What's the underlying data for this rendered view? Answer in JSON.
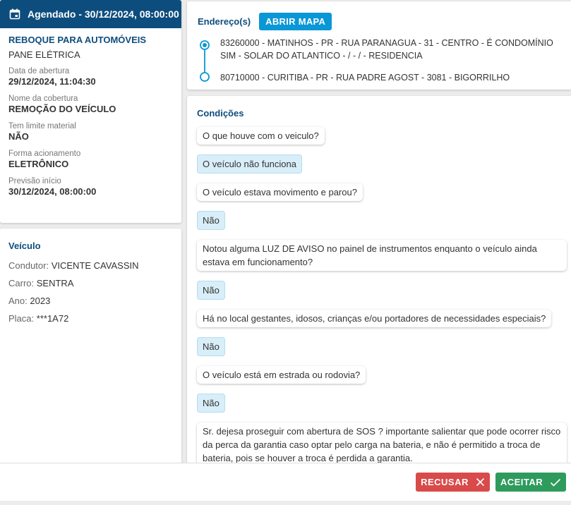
{
  "schedule": {
    "header": "Agendado - 30/12/2024, 08:00:00",
    "service_title": "REBOQUE PARA AUTOMÓVEIS",
    "service_reason": "PANE ELÉTRICA",
    "fields": [
      {
        "label": "Data de abertura",
        "value": "29/12/2024, 11:04:30"
      },
      {
        "label": "Nome da cobertura",
        "value": "REMOÇÃO DO VEÍCULO"
      },
      {
        "label": "Tem limite material",
        "value": "NÃO"
      },
      {
        "label": "Forma acionamento",
        "value": "ELETRÔNICO"
      },
      {
        "label": "Previsão início",
        "value": "30/12/2024, 08:00:00"
      }
    ]
  },
  "vehicle": {
    "title": "Veículo",
    "rows": [
      {
        "label": "Condutor:",
        "value": "VICENTE CAVASSIN"
      },
      {
        "label": "Carro:",
        "value": "SENTRA"
      },
      {
        "label": "Ano:",
        "value": "2023"
      },
      {
        "label": "Placa:",
        "value": "***1A72"
      }
    ]
  },
  "addresses": {
    "label": "Endereço(s)",
    "map_button": "ABRIR MAPA",
    "items": [
      "83260000 - MATINHOS - PR - RUA PARANAGUA - 31 - CENTRO - É CONDOMÍNIO SIM - SOLAR DO ATLANTICO - / - / - RESIDENCIA",
      "80710000 - CURITIBA - PR - RUA PADRE AGOST - 3081 - BIGORRILHO"
    ]
  },
  "conditions": {
    "title": "Condições",
    "items": [
      {
        "q": "O que houve com o veiculo?",
        "a": "O veículo não funciona"
      },
      {
        "q": "O veículo estava movimento e parou?",
        "a": "Não"
      },
      {
        "q": "Notou alguma LUZ DE AVISO no painel de instrumentos enquanto o veículo ainda estava em funcionamento?",
        "a": "Não"
      },
      {
        "q": "Há no local gestantes, idosos, crianças e/ou portadores de necessidades especiais?",
        "a": "Não"
      },
      {
        "q": "O veículo está em estrada ou rodovia?",
        "a": "Não"
      },
      {
        "q": "Sr. dejesa proseguir com abertura de SOS ? importante salientar que pode ocorrer risco da perca da garantia caso optar pelo carga na bateria, e não é permitido a troca de bateria, pois se houver a troca é perdida a garantia.",
        "a": ""
      }
    ]
  },
  "footer": {
    "reject_label": "RECUSAR",
    "accept_label": "ACEITAR"
  },
  "colors": {
    "primary": "#0d4d7e",
    "map_button": "#0a97d6",
    "answer_bg": "#d8eef9",
    "reject": "#d94a4a",
    "accept": "#2e9b5d"
  },
  "icons": {
    "header": "calendar-icon",
    "reject": "close-icon",
    "accept": "check-icon"
  }
}
